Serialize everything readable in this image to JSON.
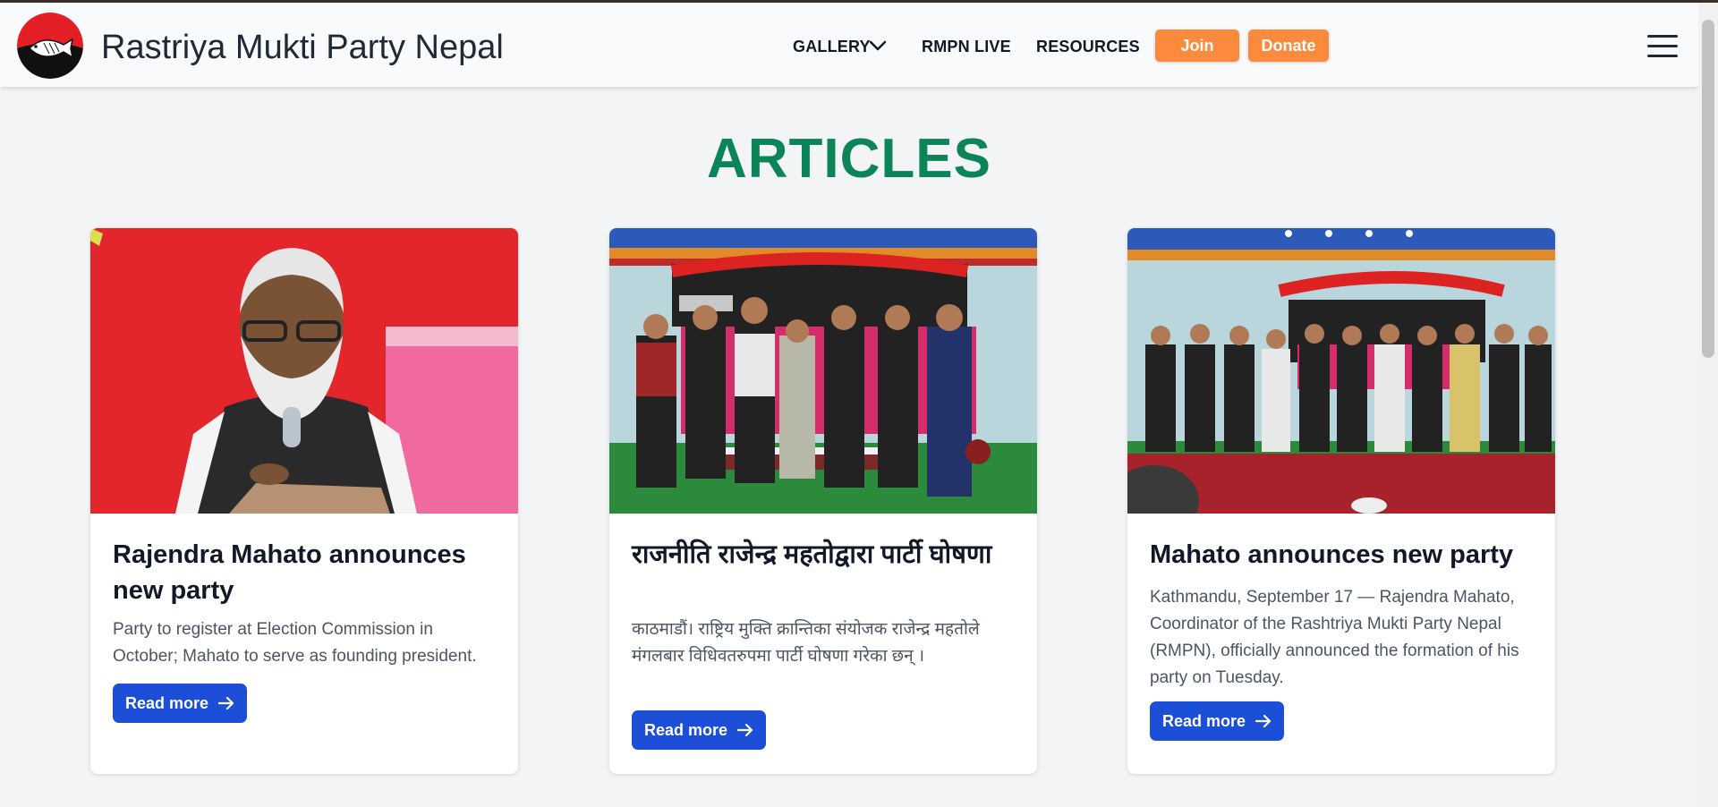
{
  "header": {
    "brand": "Rastriya Mukti Party Nepal",
    "logo_icon": "fish-logo-icon",
    "nav": {
      "gallery": "GALLERY",
      "live": "RMPN LIVE",
      "resources": "RESOURCES"
    },
    "join": "Join",
    "donate": "Donate",
    "menu_icon": "hamburger-menu-icon"
  },
  "colors": {
    "accent_orange": "#fb8a3c",
    "title_green": "#0b8457",
    "button_blue": "#1d4ed8",
    "background": "#f3f4f6"
  },
  "section": {
    "title": "ARTICLES"
  },
  "articles": [
    {
      "title": "Rajendra Mahato announces new party",
      "summary": "Party to register at Election Commission in October; Mahato to serve as founding president.",
      "button": "Read more"
    },
    {
      "title": "राजनीति राजेन्द्र महतोद्वारा पार्टी घोषणा",
      "summary": "काठमाडौं। राष्ट्रिय मुक्ति क्रान्तिका संयोजक राजेन्द्र महतोले मंगलबार विधिवतरुपमा पार्टी घोषणा गरेका छन् ।",
      "button": "Read more"
    },
    {
      "title": "Mahato announces new party",
      "summary": "Kathmandu, September 17 — Rajendra Mahato, Coordinator of the Rashtriya Mukti Party Nepal (RMPN), officially announced the formation of his party on Tuesday.",
      "button": "Read more"
    }
  ]
}
